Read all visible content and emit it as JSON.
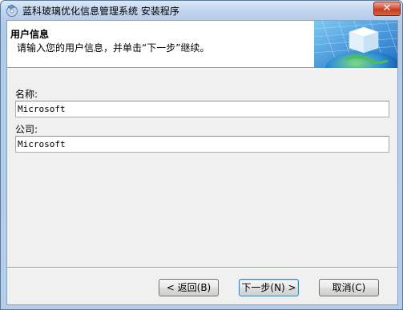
{
  "window": {
    "title": "蓝科玻璃优化信息管理系统 安装程序",
    "close_label": "✕"
  },
  "header": {
    "title": "用户信息",
    "subtitle": "请输入您的用户信息，并单击“下一步”继续。"
  },
  "form": {
    "name_label": "名称:",
    "name_value": "Microsoft",
    "company_label": "公司:",
    "company_value": "Microsoft"
  },
  "buttons": {
    "back": "< 返回(B)",
    "next": "下一步(N) >",
    "cancel": "取消(C)"
  },
  "colors": {
    "title_bar": "#c2d6ee",
    "close_button": "#d9573f",
    "dialog_bg": "#f0f0f0"
  },
  "icons": {
    "app": "installer-disc-icon",
    "banner": "globe-cube-banner"
  }
}
